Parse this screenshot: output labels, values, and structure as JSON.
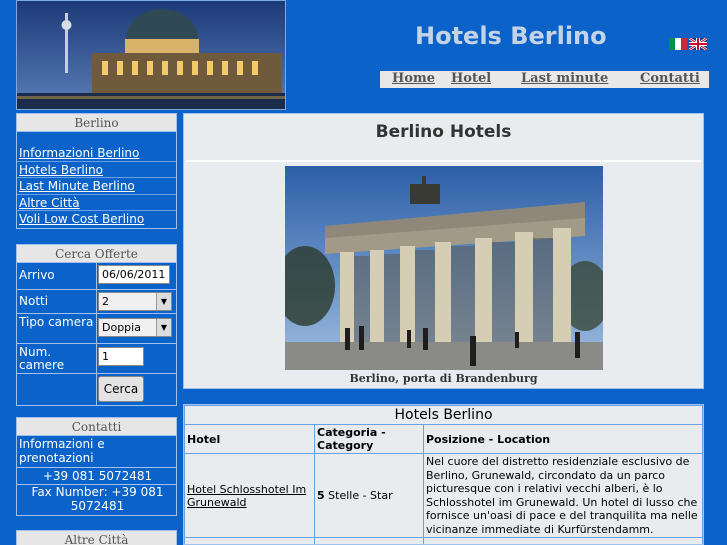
{
  "header": {
    "site_title": "Hotels Berlino",
    "nav": [
      "Home",
      "Hotel",
      "Last minute",
      "Contatti"
    ],
    "flags": [
      "italian-flag-icon",
      "uk-flag-icon"
    ]
  },
  "sidebar": {
    "berlino": {
      "title": "Berlino",
      "links": [
        "Informazioni Berlino",
        "Hotels Berlino",
        "Last Minute Berlino",
        "Altre Città",
        "Voli Low Cost Berlino"
      ]
    },
    "cerca": {
      "title": "Cerca Offerte",
      "arrivo_label": "Arrivo",
      "arrivo_value": "06/06/2011",
      "notti_label": "Notti",
      "notti_value": "2",
      "tipo_label": "Tipo camera",
      "tipo_value": "Doppia",
      "num_label": "Num. camere",
      "num_value": "1",
      "button": "Cerca"
    },
    "contatti": {
      "title": "Contatti",
      "info": "Informazioni e prenotazioni",
      "phone": "+39 081 5072481",
      "fax": "Fax Number: +39 081 5072481"
    },
    "altre": {
      "title": "Altre Città"
    }
  },
  "main": {
    "title": "Berlino Hotels",
    "caption": "Berlino, porta di Brandenburg"
  },
  "hotels": {
    "caption": "Hotels Berlino",
    "headers": [
      "Hotel",
      "Categoria - Category",
      "Posizione - Location"
    ],
    "rows": [
      {
        "name": "Hotel Schlosshotel Im Grunewald",
        "stars": "5",
        "stars_suffix": "Stelle - Star",
        "description": "Nel cuore del distretto residenziale esclusivo de Berlino, Grunewald, circondato da un parco picturesque con i relativi vecchi alberi, è lo Schlosshotel im Grunewald. Un hotel di lusso che fornisce un'oasi di pace e del tranquilita ma nelle vicinanze immediate di Kurfürstendamm."
      }
    ]
  },
  "colors": {
    "background": "#0b63c9",
    "panel": "#e9ecef",
    "border": "#9ec2ee"
  }
}
